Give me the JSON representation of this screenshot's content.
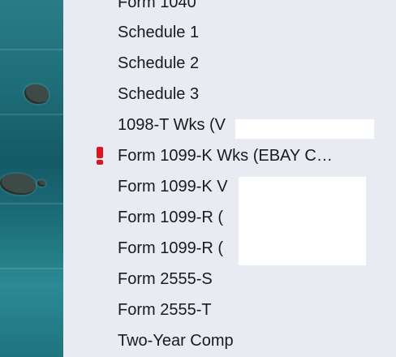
{
  "menu": {
    "items": [
      {
        "label": "Form 1040"
      },
      {
        "label": "Schedule 1"
      },
      {
        "label": "Schedule 2"
      },
      {
        "label": "Schedule 3"
      },
      {
        "label": "1098-T Wks (V"
      },
      {
        "label": "Form 1099-K Wks (EBAY C…",
        "alert": true
      },
      {
        "label": "Form 1099-K V"
      },
      {
        "label": "Form 1099-R ("
      },
      {
        "label": "Form 1099-R ("
      },
      {
        "label": "Form 2555-S"
      },
      {
        "label": "Form 2555-T"
      },
      {
        "label": "Two-Year Comp"
      }
    ]
  },
  "colors": {
    "alert": "#e0151b",
    "menu_bg": "#e8ecf2",
    "text": "#1a1a1a"
  },
  "icons": {
    "alert": "exclamation-alert-icon"
  }
}
